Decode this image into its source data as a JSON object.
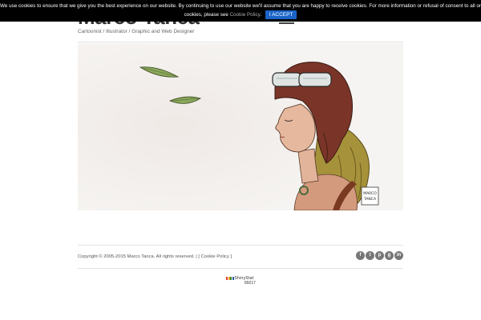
{
  "header": {
    "site_title": "Marco Tanca",
    "tagline": "Cartoonist / Illustrator / Graphic and Web Designer"
  },
  "cookie_bar": {
    "text_line1": "We use cookies to ensure that we give you the best experience on our website. By continuing to use our website we'll assume that you are happy to receive cookies. For more information or refusal of consent to all or some",
    "text_line2_prefix": "cookies, please see",
    "policy_link": "Cookie Policy",
    "text_line2_suffix": ".",
    "accept_button": "I ACCEPT"
  },
  "hero": {
    "signature_line1": "MARCO",
    "signature_line2": "TANCA"
  },
  "footer": {
    "copyright": "Copyright © 2005-2015 Marco Tanca. All rights reserved. | [",
    "policy_link": "Cookie Policy",
    "closing": "]",
    "social_icons": [
      "facebook-icon",
      "twitter-icon",
      "pinterest-icon",
      "google-plus-icon",
      "linkedin-icon"
    ]
  },
  "counter": {
    "brand": "ShinyStat",
    "count": "89217"
  }
}
